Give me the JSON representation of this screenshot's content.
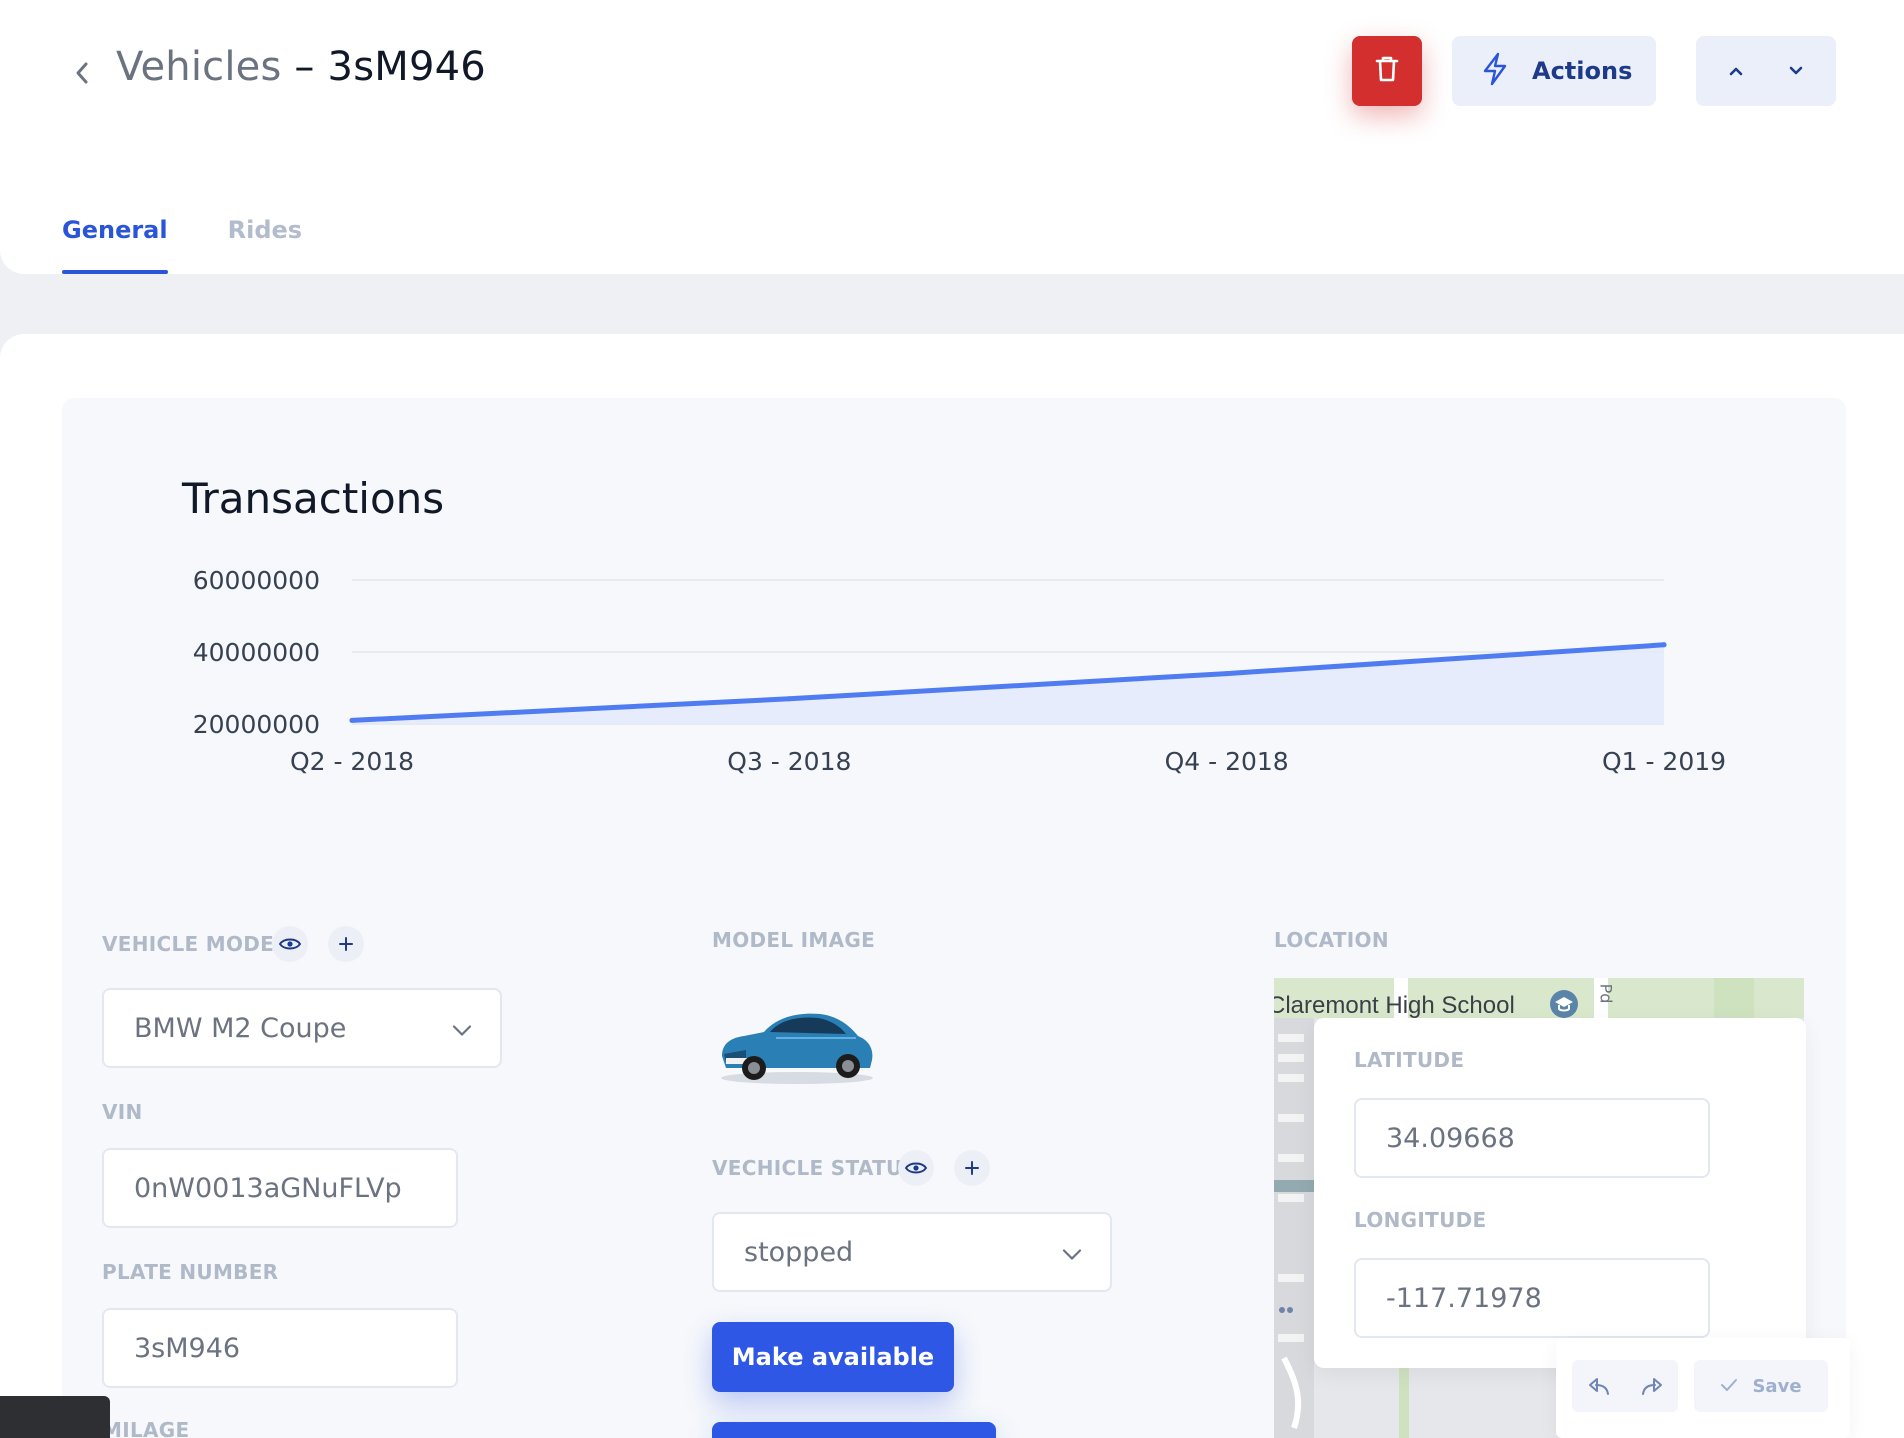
{
  "header": {
    "back_icon": "chevron-left-icon",
    "breadcrumb": "Vehicles",
    "separator": "–",
    "record_id": "3sM946",
    "delete_icon": "trash-icon",
    "actions_icon": "lightning-icon",
    "actions_label": "Actions",
    "nav_up_icon": "chevron-up-icon",
    "nav_down_icon": "chevron-down-icon"
  },
  "tabs": [
    {
      "label": "General",
      "active": true
    },
    {
      "label": "Rides",
      "active": false
    }
  ],
  "chart_data": {
    "type": "area",
    "title": "Transactions",
    "x": [
      "Q2 - 2018",
      "Q3 - 2018",
      "Q4 - 2018",
      "Q1 - 2019"
    ],
    "series": [
      {
        "values": [
          21000000,
          27000000,
          34000000,
          42000000
        ]
      }
    ],
    "yticks": [
      "60000000",
      "40000000",
      "20000000"
    ],
    "ylim": [
      20000000,
      60000000
    ],
    "grid": true,
    "line_color": "#4f7cf0",
    "fill_color": "#e4eafb"
  },
  "form": {
    "vehicle_model": {
      "label": "VEHICLE MODEL",
      "view_icon": "eye-icon",
      "add_icon": "plus-icon",
      "value": "BMW M2 Coupe"
    },
    "vin": {
      "label": "VIN",
      "value": "0nW0013aGNuFLVp"
    },
    "plate_number": {
      "label": "PLATE NUMBER",
      "value": "3sM946"
    },
    "milage": {
      "label": "MILAGE"
    },
    "model_image": {
      "label": "MODEL IMAGE",
      "image": "blue-car-image"
    },
    "vehicle_status": {
      "label": "VECHICLE STATUS",
      "view_icon": "eye-icon",
      "add_icon": "plus-icon",
      "value": "stopped"
    },
    "make_available_label": "Make available",
    "location": {
      "label": "LOCATION",
      "map_place_label": "Claremont High School",
      "map_road_label": "Pd",
      "latitude_label": "LATITUDE",
      "latitude": "34.09668",
      "longitude_label": "LONGITUDE",
      "longitude": "-117.71978"
    }
  },
  "toolbar": {
    "undo_icon": "undo-icon",
    "redo_icon": "redo-icon",
    "save_icon": "check-icon",
    "save_label": "Save"
  },
  "colors": {
    "accent": "#2f57e6",
    "danger": "#d32f2f",
    "tab_active": "#2a55d9"
  }
}
